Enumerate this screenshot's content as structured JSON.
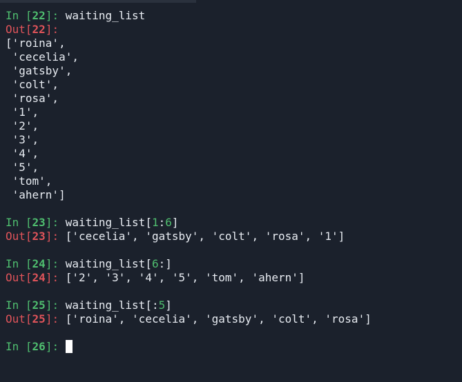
{
  "cells": [
    {
      "in_label": "In ",
      "in_open": "[",
      "in_number": "22",
      "in_close": "]: ",
      "input": "waiting_list",
      "out_label": "Out",
      "out_open": "[",
      "out_number": "22",
      "out_close": "]:",
      "output_lines": [
        "['roina',",
        " 'cecelia',",
        " 'gatsby',",
        " 'colt',",
        " 'rosa',",
        " '1',",
        " '2',",
        " '3',",
        " '4',",
        " '5',",
        " 'tom',",
        " 'ahern']"
      ]
    },
    {
      "in_label": "In ",
      "in_open": "[",
      "in_number": "23",
      "in_close": "]: ",
      "input_name": "waiting_list",
      "input_open": "[",
      "slice_start": "1",
      "slice_colon": ":",
      "slice_end": "6",
      "input_close": "]",
      "out_label": "Out",
      "out_open": "[",
      "out_number": "23",
      "out_close": "]: ",
      "output": "['cecelia', 'gatsby', 'colt', 'rosa', '1']"
    },
    {
      "in_label": "In ",
      "in_open": "[",
      "in_number": "24",
      "in_close": "]: ",
      "input_name": "waiting_list",
      "input_open": "[",
      "slice_start": "6",
      "slice_colon": ":",
      "slice_end": "",
      "input_close": "]",
      "out_label": "Out",
      "out_open": "[",
      "out_number": "24",
      "out_close": "]: ",
      "output": "['2', '3', '4', '5', 'tom', 'ahern']"
    },
    {
      "in_label": "In ",
      "in_open": "[",
      "in_number": "25",
      "in_close": "]: ",
      "input_name": "waiting_list",
      "input_open": "[",
      "slice_start": "",
      "slice_colon": ":",
      "slice_end": "5",
      "input_close": "]",
      "out_label": "Out",
      "out_open": "[",
      "out_number": "25",
      "out_close": "]: ",
      "output": "['roina', 'cecelia', 'gatsby', 'colt', 'rosa']"
    },
    {
      "in_label": "In ",
      "in_open": "[",
      "in_number": "26",
      "in_close": "]: ",
      "input": ""
    }
  ],
  "colors": {
    "background": "#1b212c",
    "text": "#e8ecf2",
    "in_prompt": "#4fbe6f",
    "out_prompt": "#e0545a",
    "cursor": "#ffffff"
  }
}
